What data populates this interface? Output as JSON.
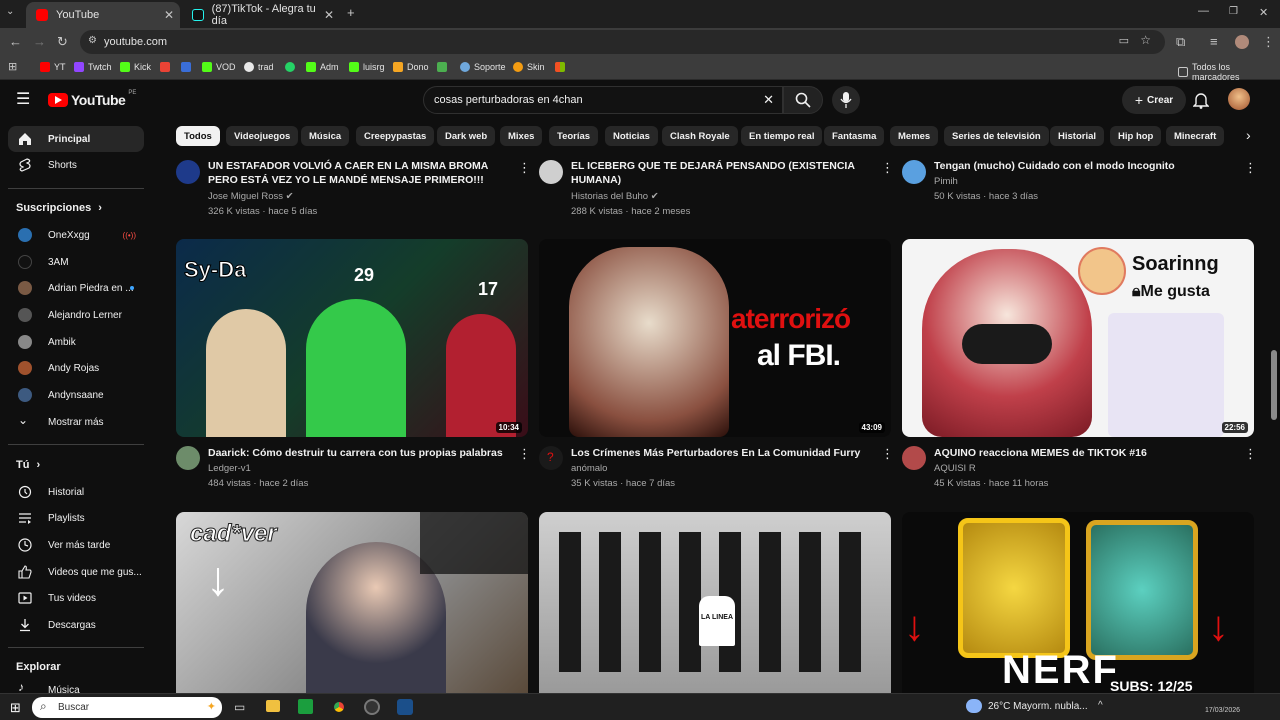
{
  "browser": {
    "tabs": [
      {
        "title": "YouTube",
        "active": true
      },
      {
        "title": "(87)TikTok - Alegra tu día",
        "active": false
      }
    ],
    "url": "youtube.com",
    "bookmarks": [
      "YT",
      "Twtch",
      "Kick",
      "VOD",
      "trad",
      "Adm",
      "luisrg",
      "Dono",
      "Soporte",
      "Skin"
    ],
    "all_bookmarks": "Todos los marcadores"
  },
  "youtube": {
    "logo": "YouTube",
    "country": "PE",
    "search_query": "cosas perturbadoras en 4chan",
    "create_label": "Crear"
  },
  "sidebar": {
    "main": [
      {
        "label": "Principal",
        "icon": "home-icon"
      },
      {
        "label": "Shorts",
        "icon": "shorts-icon"
      }
    ],
    "subs_header": "Suscripciones",
    "subscriptions": [
      "OneXxgg",
      "3AM",
      "Adrian Piedra en ...",
      "Alejandro Lerner",
      "Ambik",
      "Andy Rojas",
      "Andynsaane"
    ],
    "show_more": "Mostrar más",
    "you_header": "Tú",
    "you_items": [
      "Historial",
      "Playlists",
      "Ver más tarde",
      "Videos que me gus...",
      "Tus videos",
      "Descargas"
    ],
    "explore_header": "Explorar",
    "explore_items": [
      "Música"
    ]
  },
  "chips": [
    "Todos",
    "Videojuegos",
    "Música",
    "Creepypastas",
    "Dark web",
    "Mixes",
    "Teorías",
    "Noticias",
    "Clash Royale",
    "En tiempo real",
    "Fantasma",
    "Memes",
    "Series de televisión",
    "Historial",
    "Hip hop",
    "Minecraft"
  ],
  "top_row": [
    {
      "title": "UN ESTAFADOR VOLVIÓ A CAER EN LA MISMA BROMA PERO ESTÁ VEZ YO LE MANDÉ MENSAJE PRIMERO!!!",
      "channel": "Jose Miguel Ross",
      "meta": "326 K vistas · hace 5 días"
    },
    {
      "title": "EL ICEBERG QUE TE DEJARÁ PENSANDO (EXISTENCIA HUMANA)",
      "channel": "Historias del Buho",
      "meta": "288 K vistas · hace 2 meses"
    },
    {
      "title": "Tengan (mucho) Cuidado con el modo Incognito",
      "channel": "Pimih",
      "meta": "50 K vistas · hace 3 días"
    }
  ],
  "mid_row": [
    {
      "title": "Daarick: Cómo destruir tu carrera con tus propias palabras",
      "channel": "Ledger-v1",
      "meta": "484 vistas · hace 2 días",
      "duration": "10:34",
      "thumb_text": [
        "Sy-Da",
        "29",
        "17"
      ]
    },
    {
      "title": "Los Crímenes Más Perturbadores En La Comunidad Furry",
      "channel": "anómalo",
      "meta": "35 K vistas · hace 7 días",
      "duration": "43:09",
      "thumb_text": [
        "aterrorizó",
        "al FBI."
      ]
    },
    {
      "title": "AQUINO reacciona MEMES de TIKTOK #16",
      "channel": "AQUISI R",
      "meta": "45 K vistas · hace 11 horas",
      "duration": "22:56",
      "thumb_text": [
        "Soarinng",
        "Me gusta"
      ]
    }
  ],
  "bottom_row": [
    {
      "thumb_text": [
        "cad*ver"
      ]
    },
    {
      "thumb_text": [
        "LA LINEA"
      ]
    },
    {
      "thumb_text": [
        "NERF",
        "SUBS: 12/25"
      ]
    }
  ],
  "taskbar": {
    "search": "Buscar",
    "weather": "26°C  Mayorm. nubla...",
    "date": "17/03/2026"
  }
}
